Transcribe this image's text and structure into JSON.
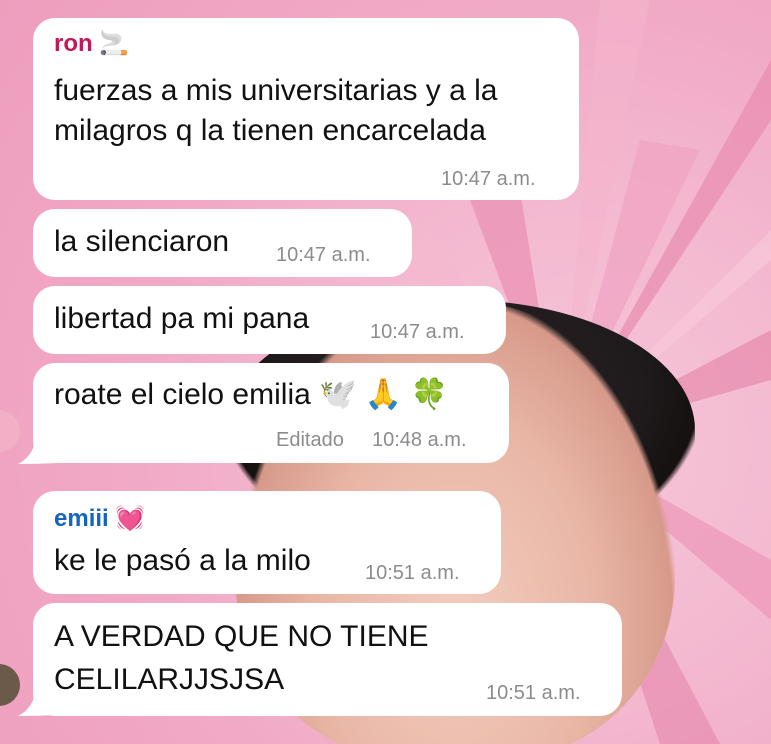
{
  "chat": {
    "messages": [
      {
        "sender": "ron",
        "sender_emoji": "🚬",
        "text_line1": "fuerzas a mis universitarias y a la",
        "text_line2": "milagros q la tienen encarcelada",
        "time": "10:47 a.m."
      },
      {
        "text": "la silenciaron",
        "time": "10:47 a.m."
      },
      {
        "text": "libertad pa mi pana",
        "time": "10:47 a.m."
      },
      {
        "text": "roate el cielo emilia",
        "emojis": "🕊️ 🙏 🍀",
        "edited_label": "Editado",
        "time": "10:48 a.m."
      },
      {
        "sender": "emiii",
        "sender_emoji": "💓",
        "text": "ke le pasó a la milo",
        "time": "10:51 a.m."
      },
      {
        "text_line1": "A VERDAD QUE NO TIENE",
        "text_line2": "CELILARJJSJSA",
        "time": "10:51 a.m."
      }
    ]
  },
  "colors": {
    "ron_name": "#c2185b",
    "emiii_name": "#1565c0",
    "bubble": "#ffffff",
    "meta_text": "#8c8c8c",
    "wallpaper_pink": "#f1aac6"
  }
}
